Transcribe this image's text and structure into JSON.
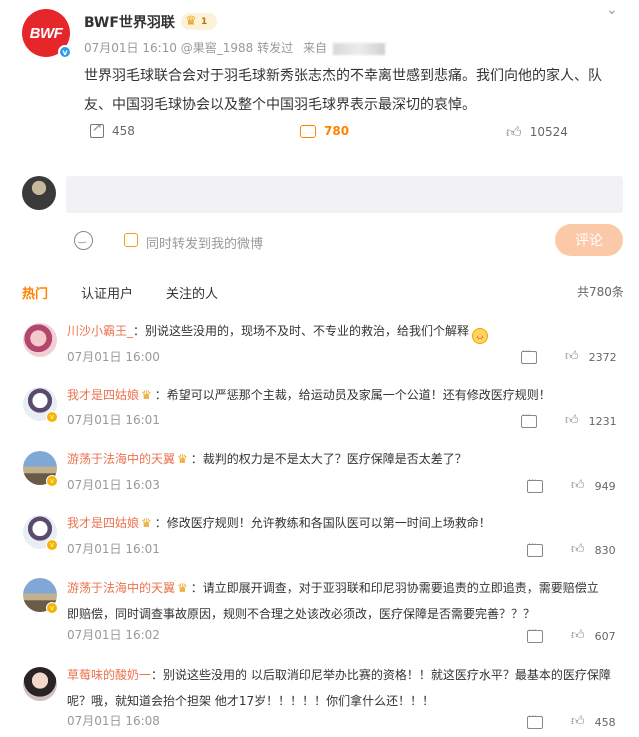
{
  "post": {
    "author": "BWF世界羽联",
    "avatar_text": "BWF",
    "level_badge": "1",
    "meta_prefix": "07月01日 16:10 @果窖_1988 转发过",
    "meta_source_label": "来自",
    "text": "世界羽毛球联合会对于羽毛球新秀张志杰的不幸离世感到悲痛。我们向他的家人、队友、中国羽毛球协会以及整个中国羽毛球界表示最深切的哀悼。",
    "share_count": "458",
    "comment_count": "780",
    "like_count": "10524"
  },
  "composer": {
    "repost_label": "同时转发到我的微博",
    "submit_label": "评论"
  },
  "tabs": [
    "热门",
    "认证用户",
    "关注的人"
  ],
  "total_comments": "共780条",
  "comments": [
    {
      "user": "川沙小霸王_",
      "text": "别说这些没用的，现场不及时、不专业的救治，给我们个解释",
      "time": "07月01日 16:00",
      "likes": "2372"
    },
    {
      "user": "我才是四姑娘",
      "text": "希望可以严惩那个主裁，给运动员及家属一个公道！还有修改医疗规则！",
      "time": "07月01日 16:01",
      "likes": "1231"
    },
    {
      "user": "游荡于法海中的天翼",
      "text": "裁判的权力是不是太大了？医疗保障是否太差了？",
      "time": "07月01日 16:03",
      "likes": "949"
    },
    {
      "user": "我才是四姑娘",
      "text": "修改医疗规则！允许教练和各国队医可以第一时间上场救命！",
      "time": "07月01日 16:01",
      "likes": "830"
    },
    {
      "user": "游荡于法海中的天翼",
      "text_line1": "请立即展开调查，对于亚羽联和印尼羽协需要追责的立即追责，需要赔偿立",
      "text_line2": "即赔偿，同时调查事故原因，规则不合理之处该改必须改，医疗保障是否需要完善？？？",
      "time": "07月01日 16:02",
      "likes": "607"
    },
    {
      "user": "草莓味的酸奶一",
      "text_line1": "别说这些没用的 以后取消印尼举办比赛的资格！！就这医疗水平？最基本的医疗保障",
      "text_line2": "呢？哦，就知道会抬个担架 他才17岁！！！！！你们拿什么还！！！",
      "time": "07月01日 16:08",
      "likes": "458"
    }
  ],
  "icons": {
    "more": "chevron-down-icon",
    "share": "share-icon",
    "comment": "comment-icon",
    "like": "thumbs-up-icon",
    "emoji": "emoji-icon",
    "crown": "crown-icon"
  }
}
